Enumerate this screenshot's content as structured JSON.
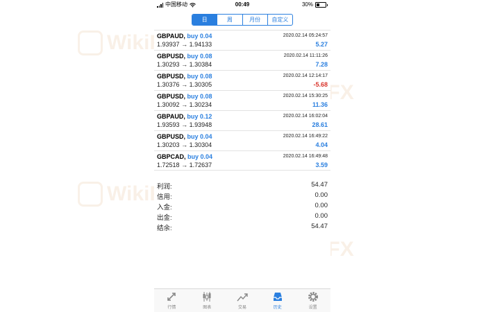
{
  "status": {
    "carrier": "中国移动",
    "time": "00:49",
    "battery": "30%"
  },
  "tabs": [
    {
      "label": "日",
      "active": true
    },
    {
      "label": "周"
    },
    {
      "label": "月份"
    },
    {
      "label": "自定义"
    }
  ],
  "trades": [
    {
      "symbol": "GBPAUD",
      "direction": "buy 0.04",
      "time": "2020.02.14 05:24:57",
      "open": "1.93937",
      "arrow": "→",
      "close": "1.94133",
      "profit": "5.27"
    },
    {
      "symbol": "GBPUSD",
      "direction": "buy 0.08",
      "time": "2020.02.14 11:11:26",
      "open": "1.30293",
      "arrow": "→",
      "close": "1.30384",
      "profit": "7.28"
    },
    {
      "symbol": "GBPUSD",
      "direction": "buy 0.08",
      "time": "2020.02.14 12:14:17",
      "open": "1.30376",
      "arrow": "→",
      "close": "1.30305",
      "profit": "-5.68"
    },
    {
      "symbol": "GBPUSD",
      "direction": "buy 0.08",
      "time": "2020.02.14 15:30:25",
      "open": "1.30092",
      "arrow": "→",
      "close": "1.30234",
      "profit": "11.36"
    },
    {
      "symbol": "GBPAUD",
      "direction": "buy 0.12",
      "time": "2020.02.14 16:02:04",
      "open": "1.93593",
      "arrow": "→",
      "close": "1.93948",
      "profit": "28.61"
    },
    {
      "symbol": "GBPUSD",
      "direction": "buy 0.04",
      "time": "2020.02.14 16:49:22",
      "open": "1.30203",
      "arrow": "→",
      "close": "1.30304",
      "profit": "4.04"
    },
    {
      "symbol": "GBPCAD",
      "direction": "buy 0.04",
      "time": "2020.02.14 16:49:48",
      "open": "1.72518",
      "arrow": "→",
      "close": "1.72637",
      "profit": "3.59"
    }
  ],
  "summary": [
    {
      "label": "利润:",
      "value": "54.47"
    },
    {
      "label": "信用:",
      "value": "0.00"
    },
    {
      "label": "入金:",
      "value": "0.00"
    },
    {
      "label": "出金:",
      "value": "0.00"
    },
    {
      "label": "结余:",
      "value": "54.47"
    }
  ],
  "tabbar": [
    {
      "label": "行情",
      "icon": "quotes-icon"
    },
    {
      "label": "图表",
      "icon": "chart-icon"
    },
    {
      "label": "交易",
      "icon": "trade-icon"
    },
    {
      "label": "历史",
      "icon": "history-icon",
      "active": true
    },
    {
      "label": "设置",
      "icon": "settings-icon"
    }
  ],
  "watermark": "WikiFX",
  "colors": {
    "accent": "#2a7fdf",
    "negative": "#d9342b"
  }
}
